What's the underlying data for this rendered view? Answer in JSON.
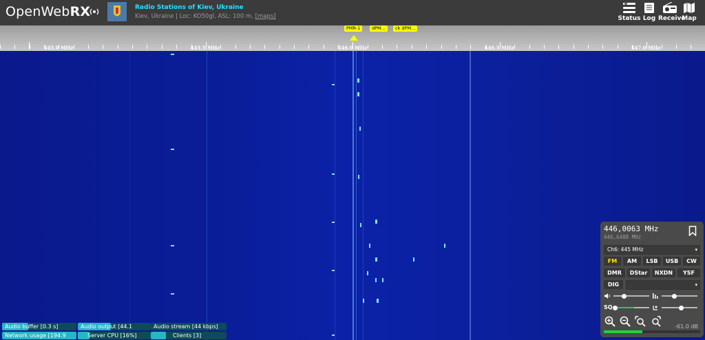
{
  "header": {
    "logo_text_1": "OpenWeb",
    "logo_text_2": "RX",
    "station_title": "Radio Stations of Kiev, Ukraine",
    "station_sub": "Kiev, Ukraine | Loc: KO50gl, ASL: 100 m,",
    "maps_link": "[maps]",
    "buttons": [
      {
        "label": "Status",
        "icon": "status-icon"
      },
      {
        "label": "Log",
        "icon": "log-icon"
      },
      {
        "label": "Receive",
        "icon": "receive-icon"
      },
      {
        "label": "Map",
        "icon": "map-icon"
      }
    ]
  },
  "scale": {
    "labels": [
      "445.0 MHz",
      "445.5 MHz",
      "446.0 MHz",
      "446.5 MHz",
      "447.0 MHz"
    ],
    "bookmarks": [
      "PMR-1",
      "dPM...",
      "ck dPM..."
    ]
  },
  "status_bars": [
    {
      "label": "Audio buffer [0.3 s]",
      "level": 0.35
    },
    {
      "label": "Audio output [44.1",
      "level": 0.45
    },
    {
      "label": "Audio stream [44 kbps]",
      "level": 0.0
    },
    {
      "label": "Network usage [194.9",
      "level": 1.0
    },
    {
      "label": "Server CPU [16%]",
      "level": 0.16
    },
    {
      "label": "Clients [3]",
      "level": 0.2
    }
  ],
  "panel": {
    "freq_main": "446,0063 MHz",
    "freq_sub": "446,6488 MHz",
    "profile": "Ch6: 445 MHz",
    "modes_row1": [
      "FM",
      "AM",
      "LSB",
      "USB",
      "CW"
    ],
    "modes_row2": [
      "DMR",
      "DStar",
      "NXDN",
      "YSF"
    ],
    "dig_label": "DIG",
    "active_mode": "FM",
    "db_readout": "-61.0 dB",
    "volume_level": 0.3,
    "squelch_level": 0.05,
    "nr_level": 0.35,
    "agc_level": 0.55,
    "smeter_level": 0.4
  },
  "colors": {
    "accent_cyan": "#22e0ff",
    "bookmark_yellow": "#ffff00",
    "waterfall_blue": "#0a1d98",
    "status_fill": "#27b5c7",
    "smeter_green": "#21d13f"
  }
}
